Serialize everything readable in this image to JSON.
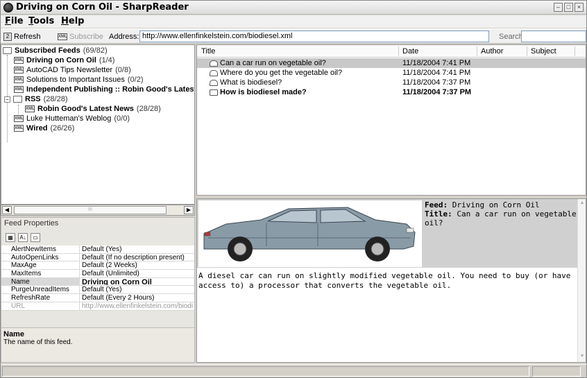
{
  "window": {
    "title": "Driving on Corn Oil - SharpReader",
    "buttons": [
      "minimize",
      "maximize",
      "close"
    ]
  },
  "menu": [
    {
      "label": "File",
      "accel": "F"
    },
    {
      "label": "Tools",
      "accel": "T"
    },
    {
      "label": "Help",
      "accel": "H"
    }
  ],
  "toolbar": {
    "refresh_label": "Refresh",
    "subscribe_label": "Subscribe",
    "address_label": "Address:",
    "address_value": "http://www.ellenfinkelstein.com/biodiesel.xml",
    "search_label": "Search:",
    "search_value": ""
  },
  "tree": {
    "root": {
      "label": "Subscribed Feeds",
      "count": "(69/82)"
    },
    "items": [
      {
        "label": "Driving on Corn Oil",
        "count": "(1/4)",
        "bold": true
      },
      {
        "label": "AutoCAD Tips Newsletter",
        "count": "(0/8)",
        "bold": false
      },
      {
        "label": "Solutions to Important Issues",
        "count": "(0/2)",
        "bold": false
      },
      {
        "label": "Independent Publishing :: Robin Good's Latest I",
        "count": "",
        "bold": true
      }
    ],
    "folder": {
      "label": "RSS",
      "count": "(28/28)"
    },
    "folder_items": [
      {
        "label": "Robin Good's Latest News",
        "count": "(28/28)",
        "bold": true
      }
    ],
    "tail_items": [
      {
        "label": "Luke Hutteman's Weblog",
        "count": "(0/0)",
        "bold": false
      },
      {
        "label": "Wired",
        "count": "(26/26)",
        "bold": true
      }
    ]
  },
  "properties": {
    "legend": "Feed Properties",
    "rows": [
      {
        "key": "AlertNewItems",
        "value": "Default (Yes)"
      },
      {
        "key": "AutoOpenLinks",
        "value": "Default (If no description present)"
      },
      {
        "key": "MaxAge",
        "value": "Default (2 Weeks)"
      },
      {
        "key": "MaxItems",
        "value": "Default (Unlimited)"
      },
      {
        "key": "Name",
        "value": "Driving on Corn Oil"
      },
      {
        "key": "PurgeUnreadItems",
        "value": "Default (Yes)"
      },
      {
        "key": "RefreshRate",
        "value": "Default (Every 2 Hours)"
      },
      {
        "key": "URL",
        "value": "http://www.ellenfinkelstein.com/biodi"
      }
    ],
    "description_title": "Name",
    "description_text": "The name of this feed."
  },
  "list": {
    "columns": [
      "Title",
      "Date",
      "Author",
      "Subject"
    ],
    "rows": [
      {
        "title": "Can a car run on vegetable oil?",
        "date": "11/18/2004 7:41 PM",
        "bold": false,
        "selected": true
      },
      {
        "title": "Where do you get the vegetable oil?",
        "date": "11/18/2004 7:41 PM",
        "bold": false,
        "selected": false
      },
      {
        "title": "What is biodiesel?",
        "date": "11/18/2004 7:37 PM",
        "bold": false,
        "selected": false
      },
      {
        "title": "How is biodiesel made?",
        "date": "11/18/2004 7:37 PM",
        "bold": true,
        "selected": false
      }
    ]
  },
  "preview": {
    "feed_label": "Feed:",
    "feed_value": "Driving on Corn Oil",
    "title_label": "Title:",
    "title_value": "Can a car run on vegetable oil?",
    "body": "A diesel car can run on slightly modified vegetable oil. You need to buy (or have access to) a processor that converts the vegetable oil."
  },
  "colors": {
    "car_body": "#8a9ba8",
    "selection": "#c8c8c8",
    "preview_header": "#d0d0d0"
  }
}
